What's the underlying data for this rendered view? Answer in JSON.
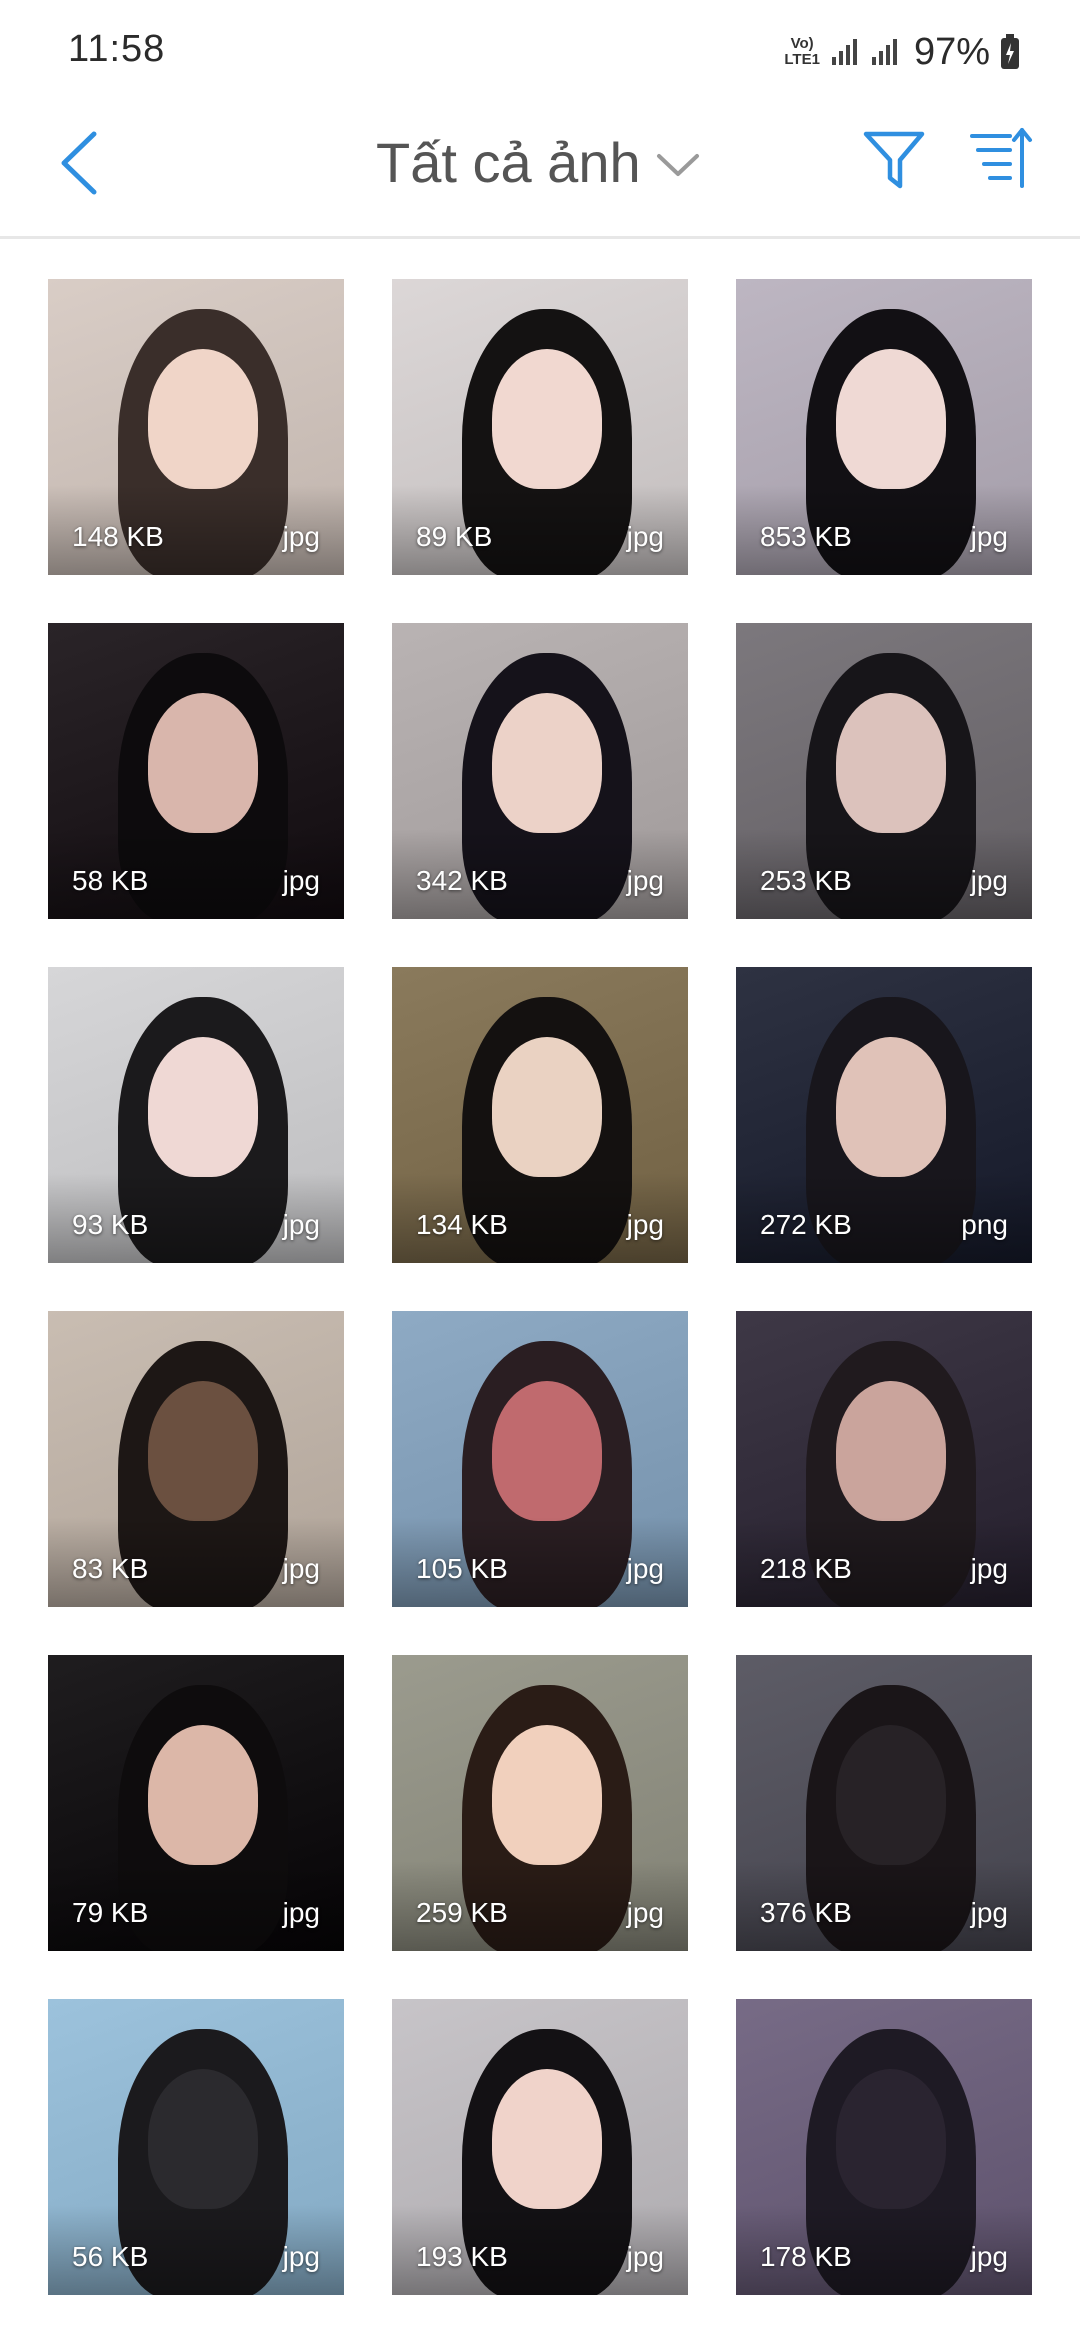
{
  "status_bar": {
    "time": "11:58",
    "network_label_top": "Vo)",
    "network_label_bottom": "LTE1",
    "battery": "97%"
  },
  "header": {
    "title": "Tất cả ảnh",
    "back_icon": "chevron-left-icon",
    "dropdown_icon": "chevron-down-icon",
    "filter_icon": "filter-icon",
    "sort_icon": "sort-icon"
  },
  "colors": {
    "accent": "#2f8fe0"
  },
  "photos": [
    {
      "size": "148 KB",
      "type": "jpg",
      "bg": "#d9cdc6",
      "fig": "#f0d5c8",
      "hair": "#3a2e2a"
    },
    {
      "size": "89 KB",
      "type": "jpg",
      "bg": "#dcd7d7",
      "fig": "#f1d8d0",
      "hair": "#141212"
    },
    {
      "size": "853 KB",
      "type": "jpg",
      "bg": "#bdb6c2",
      "fig": "#efd9d4",
      "hair": "#121014"
    },
    {
      "size": "58 KB",
      "type": "jpg",
      "bg": "#2a2428",
      "fig": "#d9b6ac",
      "hair": "#0d0b0d"
    },
    {
      "size": "342 KB",
      "type": "jpg",
      "bg": "#b9b3b3",
      "fig": "#ecd2c8",
      "hair": "#15121a"
    },
    {
      "size": "253 KB",
      "type": "jpg",
      "bg": "#7c787d",
      "fig": "#dcc2bc",
      "hair": "#171519"
    },
    {
      "size": "93 KB",
      "type": "jpg",
      "bg": "#d6d6d8",
      "fig": "#efd8d4",
      "hair": "#1b1a1c"
    },
    {
      "size": "134 KB",
      "type": "jpg",
      "bg": "#8a7a5c",
      "fig": "#ead2c2",
      "hair": "#141110"
    },
    {
      "size": "272 KB",
      "type": "png",
      "bg": "#2e3242",
      "fig": "#e0c2b8",
      "hair": "#18161c"
    },
    {
      "size": "83 KB",
      "type": "jpg",
      "bg": "#c9bdb2",
      "fig": "#6b5040",
      "hair": "#1d1715"
    },
    {
      "size": "105 KB",
      "type": "jpg",
      "bg": "#8eaac4",
      "fig": "#c06a6e",
      "hair": "#2a1e22"
    },
    {
      "size": "218 KB",
      "type": "jpg",
      "bg": "#3e3846",
      "fig": "#caa49c",
      "hair": "#201a1e"
    },
    {
      "size": "79 KB",
      "type": "jpg",
      "bg": "#1f1d1f",
      "fig": "#dcb7a8",
      "hair": "#0e0c0d"
    },
    {
      "size": "259 KB",
      "type": "jpg",
      "bg": "#9b9b8e",
      "fig": "#f1d0bd",
      "hair": "#2a1c16"
    },
    {
      "size": "376 KB",
      "type": "jpg",
      "bg": "#5d5c66",
      "fig": "#272226",
      "hair": "#1a1518"
    },
    {
      "size": "56 KB",
      "type": "jpg",
      "bg": "#9cc2dc",
      "fig": "#2b2a2e",
      "hair": "#1b1a1d"
    },
    {
      "size": "193 KB",
      "type": "jpg",
      "bg": "#c7c4c8",
      "fig": "#f0d3ca",
      "hair": "#131114"
    },
    {
      "size": "178 KB",
      "type": "jpg",
      "bg": "#776b86",
      "fig": "#2a2430",
      "hair": "#1e1a24"
    }
  ]
}
